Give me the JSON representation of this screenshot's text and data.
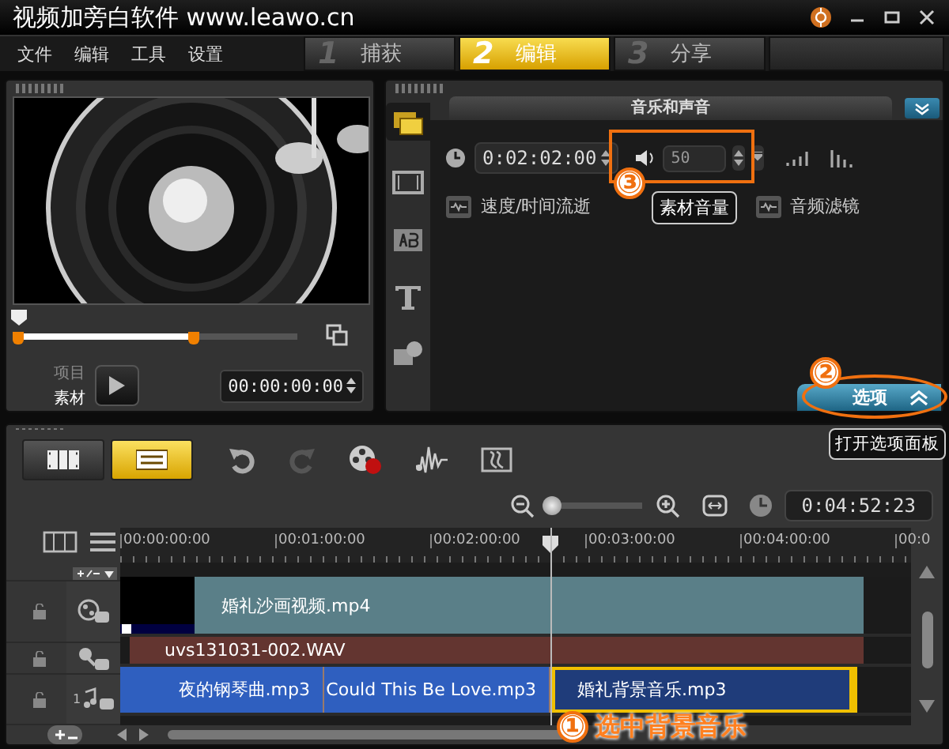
{
  "window": {
    "title": "视频加旁白软件 www.leawo.cn"
  },
  "menu": [
    "文件",
    "编辑",
    "工具",
    "设置"
  ],
  "steps": [
    {
      "number": "1",
      "label": "捕获",
      "selected": false
    },
    {
      "number": "2",
      "label": "编辑",
      "selected": true
    },
    {
      "number": "3",
      "label": "分享",
      "selected": false
    }
  ],
  "preview": {
    "kind": "picture",
    "scrub": {
      "level": 0
    },
    "trim": {
      "level": 0.63
    },
    "modes": [
      {
        "label": "项目",
        "selected": false
      },
      {
        "label": "素材",
        "selected": true
      }
    ],
    "timecode": "00:00:00:00"
  },
  "options": {
    "title": "音乐和声音",
    "duration": "0:02:02:00",
    "volume": "50",
    "links": [
      "速度/时间流逝",
      "音频滤镜"
    ],
    "side_tabs": [
      {
        "kind": "media",
        "selected": true
      },
      {
        "kind": "video",
        "selected": false
      },
      {
        "kind": "transition",
        "selected": false
      },
      {
        "kind": "title",
        "selected": false
      },
      {
        "kind": "effect",
        "selected": false
      }
    ],
    "options_button": "选项"
  },
  "timeline": {
    "view_buttons": [
      {
        "kind": "storyboard",
        "selected": false
      },
      {
        "kind": "timeline",
        "selected": true
      }
    ],
    "zoom": {
      "level": 0.05
    },
    "duration": "0:04:52:23",
    "ruler": [
      "00:00:00:00",
      "00:01:00:00",
      "00:02:00:00",
      "00:03:00:00",
      "00:04:00:00",
      "00:0"
    ],
    "tracks": [
      {
        "kind": "video",
        "clips": [
          {
            "label": "婚礼沙画视频.mp4"
          }
        ]
      },
      {
        "kind": "voice",
        "clips": [
          {
            "label": "uvs131031-002.WAV"
          }
        ]
      },
      {
        "kind": "music",
        "number": "1",
        "clips": [
          {
            "label": "夜的钢琴曲.mp3",
            "selected": false
          },
          {
            "label": "Could This Be Love.mp3",
            "selected": false
          },
          {
            "label": "婚礼背景音乐.mp3",
            "selected": true
          }
        ]
      }
    ]
  },
  "annotations": [
    {
      "number": "③",
      "tooltip": "素材音量"
    },
    {
      "number": "②",
      "tooltip": "打开选项面板"
    },
    {
      "number": "①",
      "text": "选中背景音乐"
    }
  ]
}
